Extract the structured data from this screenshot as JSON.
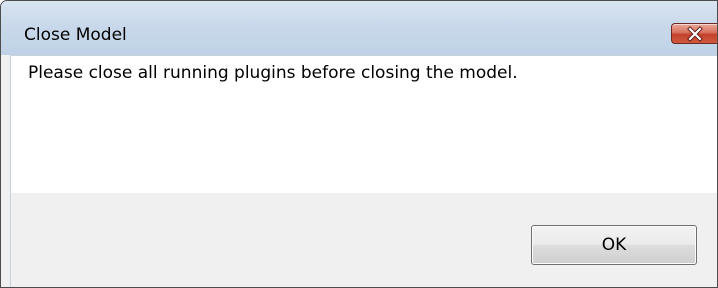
{
  "window": {
    "title": "Close Model",
    "close_icon": "close-x-icon"
  },
  "dialog": {
    "message": "Please close all running plugins before closing the model.",
    "ok_label": "OK"
  },
  "colors": {
    "titlebar": "#c9d9eb",
    "close_button": "#c7432d",
    "content_background": "#ffffff",
    "footer_background": "#f0f0f0"
  }
}
